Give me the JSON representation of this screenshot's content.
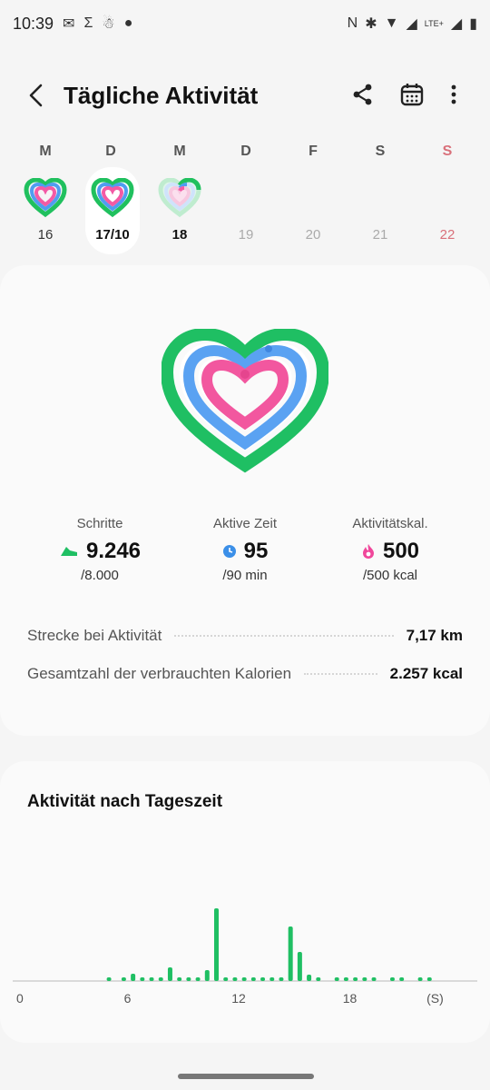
{
  "status_bar": {
    "time": "10:39",
    "network": "LTE+"
  },
  "header": {
    "title": "Tägliche Aktivität"
  },
  "days": [
    {
      "letter": "M",
      "number": "16",
      "ring": true
    },
    {
      "letter": "D",
      "number": "17/10",
      "ring": true,
      "selected": true
    },
    {
      "letter": "M",
      "number": "18",
      "ring": true,
      "today": true
    },
    {
      "letter": "D",
      "number": "19"
    },
    {
      "letter": "F",
      "number": "20"
    },
    {
      "letter": "S",
      "number": "21"
    },
    {
      "letter": "S",
      "number": "22",
      "sunday": true
    }
  ],
  "metrics": {
    "steps": {
      "label": "Schritte",
      "value": "9.246",
      "goal": "/8.000",
      "color": "#1fbf63"
    },
    "active_time": {
      "label": "Aktive Zeit",
      "value": "95",
      "goal": "/90 min",
      "color": "#3b8fe8"
    },
    "calories": {
      "label": "Aktivitätskal.",
      "value": "500",
      "goal": "/500 kcal",
      "color": "#f0479b"
    }
  },
  "rows": [
    {
      "label": "Strecke bei Aktivität",
      "value": "7,17 km"
    },
    {
      "label": "Gesamtzahl der verbrauchten Kalorien",
      "value": "2.257 kcal"
    }
  ],
  "activity_chart": {
    "title": "Aktivität nach Tageszeit",
    "color": "#1fbf63"
  },
  "chart_data": {
    "type": "bar",
    "xlabel": "",
    "ylabel": "",
    "x_ticks": [
      "0",
      "6",
      "12",
      "18",
      "(S)"
    ],
    "x_range": [
      0,
      24
    ],
    "x": [
      5.0,
      5.8,
      6.3,
      6.8,
      7.3,
      7.8,
      8.3,
      8.8,
      9.3,
      9.8,
      10.3,
      10.8,
      11.3,
      11.8,
      12.3,
      12.8,
      13.3,
      13.8,
      14.3,
      14.8,
      15.3,
      15.8,
      16.3,
      17.3,
      17.8,
      18.3,
      18.8,
      19.3,
      20.3,
      20.8,
      21.8,
      22.3
    ],
    "values": [
      4,
      4,
      8,
      4,
      4,
      4,
      15,
      4,
      4,
      4,
      12,
      80,
      4,
      4,
      4,
      4,
      4,
      4,
      4,
      60,
      32,
      7,
      4,
      4,
      4,
      4,
      4,
      4,
      4,
      4,
      4,
      4
    ],
    "ylim": [
      0,
      100
    ]
  }
}
